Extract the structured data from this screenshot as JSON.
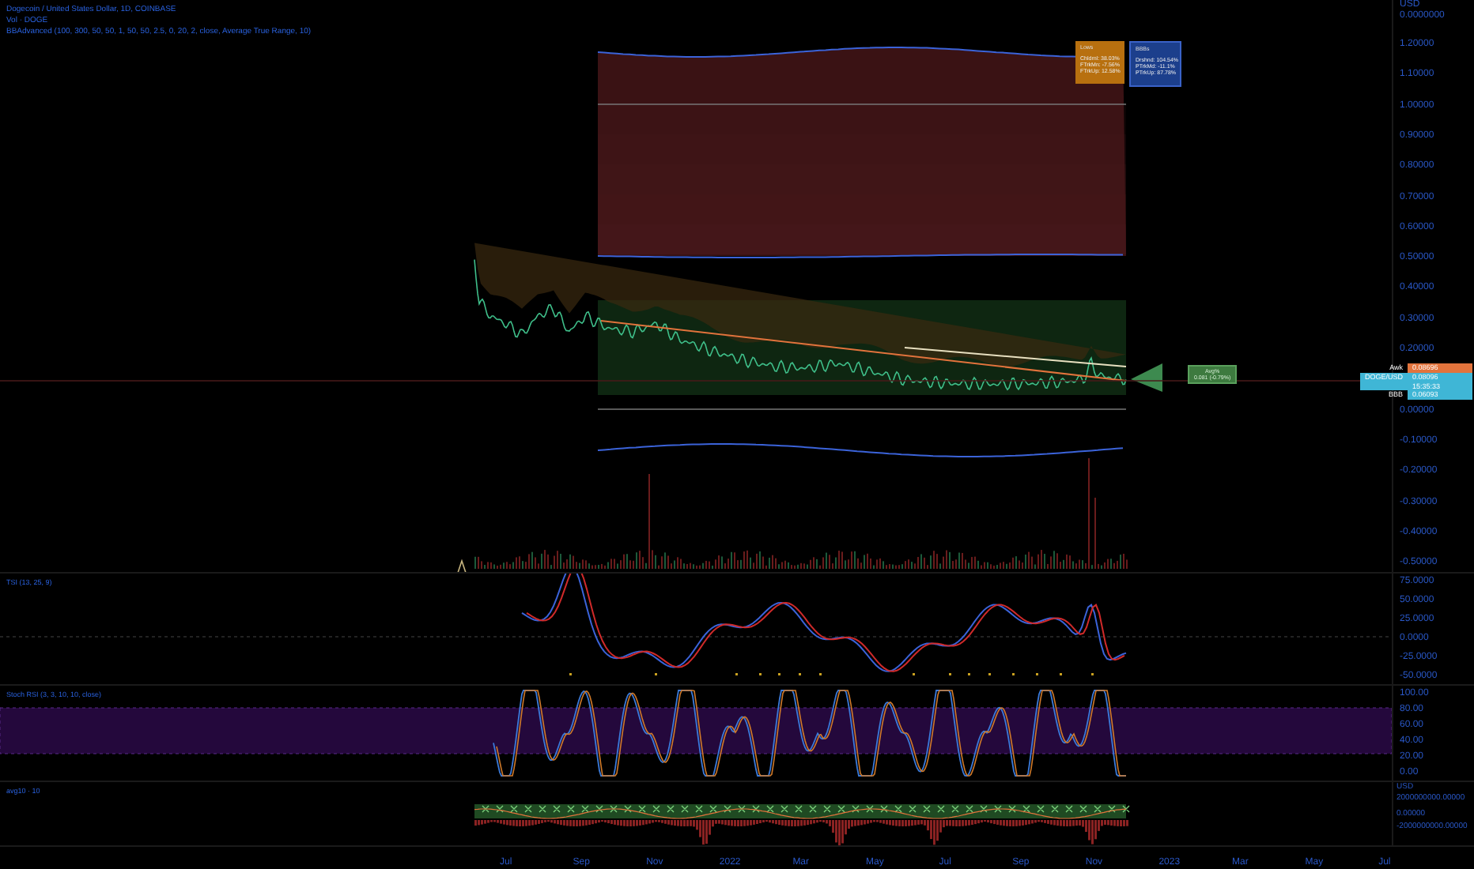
{
  "legend": [
    "Dogecoin / United States Dollar, 1D, COINBASE",
    "Vol · DOGE",
    "BBAdvanced (100, 300, 50, 50, 1, 50, 50, 2.5, 0, 20, 2, close, Average True Range, 10)"
  ],
  "info_boxes": [
    {
      "color": "#b8700f",
      "title": "Lows",
      "lines": [
        "Chldrnl: 38.03%",
        "FTrkMn: -7.56%",
        "FTrkUp: 12.58%"
      ]
    },
    {
      "color": "#1c3f8c",
      "title": "BBBs",
      "lines": [
        "Drshnd: 104.54%",
        "PTrkMd: -11.1%",
        "PTrkUp: 87.78%"
      ]
    }
  ],
  "avg_label": {
    "lines": [
      "Avg%",
      "0.081 (-0.79%)"
    ]
  },
  "price_axis": {
    "currency": "USD",
    "subtitle": "0.0000000",
    "ticks": [
      "1.20000",
      "1.10000",
      "1.00000",
      "0.90000",
      "0.80000",
      "0.70000",
      "0.60000",
      "0.50000",
      "0.40000",
      "0.30000",
      "0.20000",
      "0.00000",
      "-0.10000",
      "-0.20000",
      "-0.30000",
      "-0.40000",
      "-0.50000"
    ]
  },
  "price_tags": [
    {
      "kind": "label",
      "color": "#e2733c",
      "name": "Awk",
      "value": "0.08696"
    },
    {
      "kind": "last",
      "color": "#3fb6d6",
      "name": "DOGE/USD",
      "value": "0.08096",
      "countdown": "15:35:33"
    },
    {
      "kind": "label",
      "color": "#3fb6d6",
      "name": "BBB",
      "value": "0.06093"
    }
  ],
  "panes": [
    {
      "kind": "tsi",
      "title": "TSI (13, 25, 9)",
      "ticks": [
        "75.0000",
        "50.0000",
        "25.0000",
        "0.0000",
        "-25.0000",
        "-50.0000"
      ]
    },
    {
      "kind": "stoch",
      "title": "Stoch RSI (3, 3, 10, 10, close)",
      "ticks": [
        "100.00",
        "80.00",
        "60.00",
        "40.00",
        "20.00",
        "0.00"
      ]
    },
    {
      "kind": "avg",
      "title": "avg10 · 10",
      "currency": "USD",
      "subtitle": "2000000000.00000",
      "ticks": [
        "0.00000",
        "-2000000000.00000"
      ]
    }
  ],
  "time_axis": [
    "Jul",
    "Sep",
    "Nov",
    "2022",
    "Mar",
    "May",
    "Jul",
    "Sep",
    "Nov",
    "2023",
    "Mar",
    "May",
    "Jul"
  ]
}
